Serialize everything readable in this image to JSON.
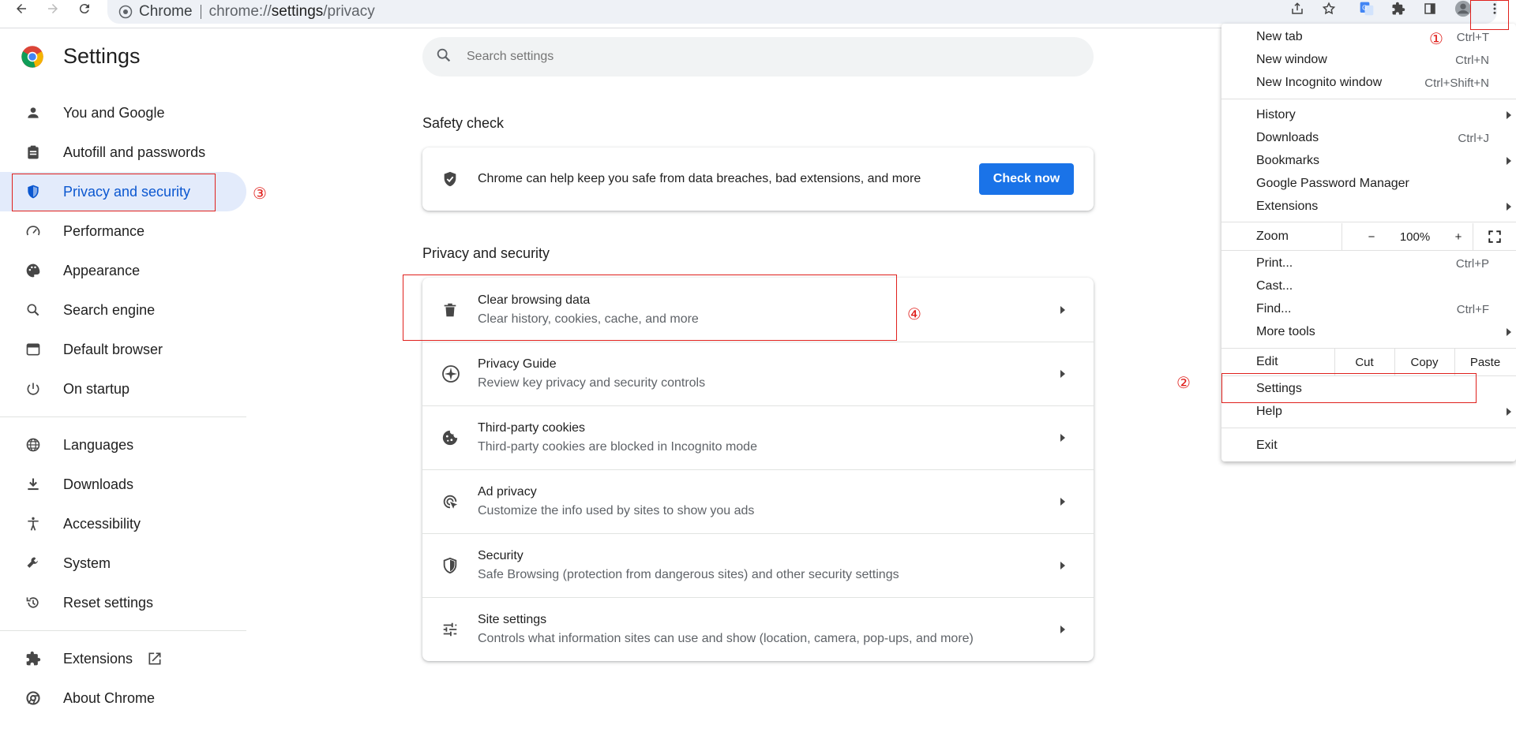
{
  "browser": {
    "site_label": "Chrome",
    "url_prefix": "chrome://",
    "url_host": "settings",
    "url_path": "/privacy"
  },
  "settings": {
    "title": "Settings",
    "search_placeholder": "Search settings",
    "nav": [
      {
        "label": "You and Google",
        "icon": "person-icon"
      },
      {
        "label": "Autofill and passwords",
        "icon": "clipboard-icon"
      },
      {
        "label": "Privacy and security",
        "icon": "shield-icon",
        "active": true
      },
      {
        "label": "Performance",
        "icon": "speedometer-icon"
      },
      {
        "label": "Appearance",
        "icon": "palette-icon"
      },
      {
        "label": "Search engine",
        "icon": "search-icon"
      },
      {
        "label": "Default browser",
        "icon": "browser-window-icon"
      },
      {
        "label": "On startup",
        "icon": "power-icon"
      },
      {
        "label": "Languages",
        "icon": "globe-icon"
      },
      {
        "label": "Downloads",
        "icon": "download-icon"
      },
      {
        "label": "Accessibility",
        "icon": "accessibility-icon"
      },
      {
        "label": "System",
        "icon": "wrench-icon"
      },
      {
        "label": "Reset settings",
        "icon": "history-icon"
      },
      {
        "label": "Extensions",
        "icon": "puzzle-icon"
      },
      {
        "label": "About Chrome",
        "icon": "chrome-icon"
      }
    ]
  },
  "safety_check": {
    "section_title": "Safety check",
    "text": "Chrome can help keep you safe from data breaches, bad extensions, and more",
    "button": "Check now"
  },
  "privacy": {
    "section_title": "Privacy and security",
    "rows": [
      {
        "title": "Clear browsing data",
        "subtitle": "Clear history, cookies, cache, and more",
        "icon": "trash-icon"
      },
      {
        "title": "Privacy Guide",
        "subtitle": "Review key privacy and security controls",
        "icon": "compass-icon"
      },
      {
        "title": "Third-party cookies",
        "subtitle": "Third-party cookies are blocked in Incognito mode",
        "icon": "cookie-icon"
      },
      {
        "title": "Ad privacy",
        "subtitle": "Customize the info used by sites to show you ads",
        "icon": "ad-target-icon"
      },
      {
        "title": "Security",
        "subtitle": "Safe Browsing (protection from dangerous sites) and other security settings",
        "icon": "shield-icon"
      },
      {
        "title": "Site settings",
        "subtitle": "Controls what information sites can use and show (location, camera, pop-ups, and more)",
        "icon": "sliders-icon"
      }
    ]
  },
  "menu": {
    "new_tab": "New tab",
    "new_tab_sc": "Ctrl+T",
    "new_window": "New window",
    "new_window_sc": "Ctrl+N",
    "incognito": "New Incognito window",
    "incognito_sc": "Ctrl+Shift+N",
    "history": "History",
    "downloads": "Downloads",
    "downloads_sc": "Ctrl+J",
    "bookmarks": "Bookmarks",
    "password_manager": "Google Password Manager",
    "extensions": "Extensions",
    "zoom": "Zoom",
    "zoom_minus": "−",
    "zoom_value": "100%",
    "zoom_plus": "+",
    "print": "Print...",
    "print_sc": "Ctrl+P",
    "cast": "Cast...",
    "find": "Find...",
    "find_sc": "Ctrl+F",
    "more_tools": "More tools",
    "edit": "Edit",
    "cut": "Cut",
    "copy": "Copy",
    "paste": "Paste",
    "settings": "Settings",
    "help": "Help",
    "exit": "Exit"
  },
  "annotations": {
    "a1": "①",
    "a2": "②",
    "a3": "③",
    "a4": "④",
    "color": "#e0201c"
  }
}
